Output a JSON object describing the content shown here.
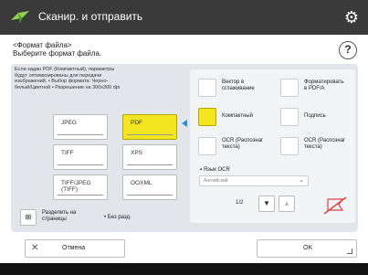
{
  "header": {
    "title": "Сканир. и отправить"
  },
  "subtitle": {
    "line1": "<Формат файла>",
    "line2": "Выберите формат файла."
  },
  "info": {
    "text": "Если задан PDF (Компактный), параметры будут оптимизированы для передачи изображений. • Выбор формата: Черно-белый/Цветной • Разрешение на 300x300 dpi"
  },
  "formats": [
    {
      "label": "JPEG",
      "selected": false
    },
    {
      "label": "PDF",
      "selected": true
    },
    {
      "label": "TIFF",
      "selected": false
    },
    {
      "label": "XPS",
      "selected": false
    },
    {
      "label": "TIFF/JPEG\n(TIFF)",
      "selected": false
    },
    {
      "label": "OOXML",
      "selected": false
    }
  ],
  "options": [
    {
      "label": "Вектор в\nсглаживание"
    },
    {
      "label": "Форматировать\nв PDF/A"
    },
    {
      "label": "Компактный",
      "selected": true
    },
    {
      "label": "Подпись"
    },
    {
      "label": "OCR (Распознаг\nтекста)"
    },
    {
      "label": "OCR (Распознаг\nтекста)"
    }
  ],
  "ocr": {
    "label": "▪ Язык OCR",
    "value": "Английский"
  },
  "pager": {
    "text": "1/2"
  },
  "split": {
    "label": "Разделить на\nстраницы",
    "value": "• Без разд."
  },
  "buttons": {
    "cancel": "Отмена",
    "ok": "OK"
  },
  "colors": {
    "accent": "#f3e520",
    "arrow": "#2c8bd8"
  }
}
